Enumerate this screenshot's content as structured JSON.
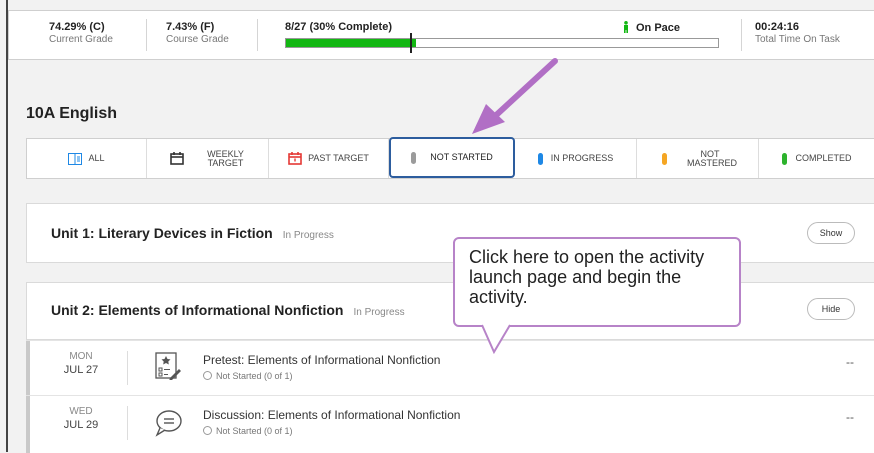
{
  "stats": {
    "current_grade_value": "74.29% (C)",
    "current_grade_label": "Current Grade",
    "course_grade_value": "7.43% (F)",
    "course_grade_label": "Course Grade",
    "progress_text": "8/27 (30% Complete)",
    "progress_fraction": 0.3,
    "pace_text": "On Pace",
    "time_value": "00:24:16",
    "time_label": "Total Time On Task"
  },
  "course_title": "10A English",
  "filters": [
    {
      "label": "ALL",
      "icon": "list-icon"
    },
    {
      "label": "WEEKLY TARGET",
      "icon": "calendar-icon"
    },
    {
      "label": "PAST TARGET",
      "icon": "calendar-alert-icon"
    },
    {
      "label": "NOT STARTED",
      "icon": "gray-pill-icon"
    },
    {
      "label": "IN PROGRESS",
      "icon": "blue-pill-icon"
    },
    {
      "label": "NOT MASTERED",
      "icon": "orange-pill-icon"
    },
    {
      "label": "COMPLETED",
      "icon": "green-pill-icon"
    }
  ],
  "units": [
    {
      "name": "Unit 1: Literary Devices in Fiction",
      "status": "In Progress",
      "toggle": "Show"
    },
    {
      "name": "Unit 2: Elements of Informational Nonfiction",
      "status": "In Progress",
      "toggle": "Hide"
    }
  ],
  "activities": [
    {
      "dow": "MON",
      "date": "JUL 27",
      "name": "Pretest: Elements of Informational Nonfiction",
      "status": "Not Started (0 of 1)",
      "score": "--",
      "icon": "quiz-icon"
    },
    {
      "dow": "WED",
      "date": "JUL 29",
      "name": "Discussion: Elements of Informational Nonfiction",
      "status": "Not Started (0 of 1)",
      "score": "--",
      "icon": "chat-icon"
    }
  ],
  "callout_text": "Click here to open the activity launch page and begin the activity.",
  "colors": {
    "accent": "#2d5d9e",
    "progress": "#13b713",
    "annotation": "#b783c8",
    "gray": "#9b9b9b",
    "blue": "#1e88e5",
    "orange": "#f5a623",
    "green": "#2db32d",
    "red": "#e53935"
  }
}
